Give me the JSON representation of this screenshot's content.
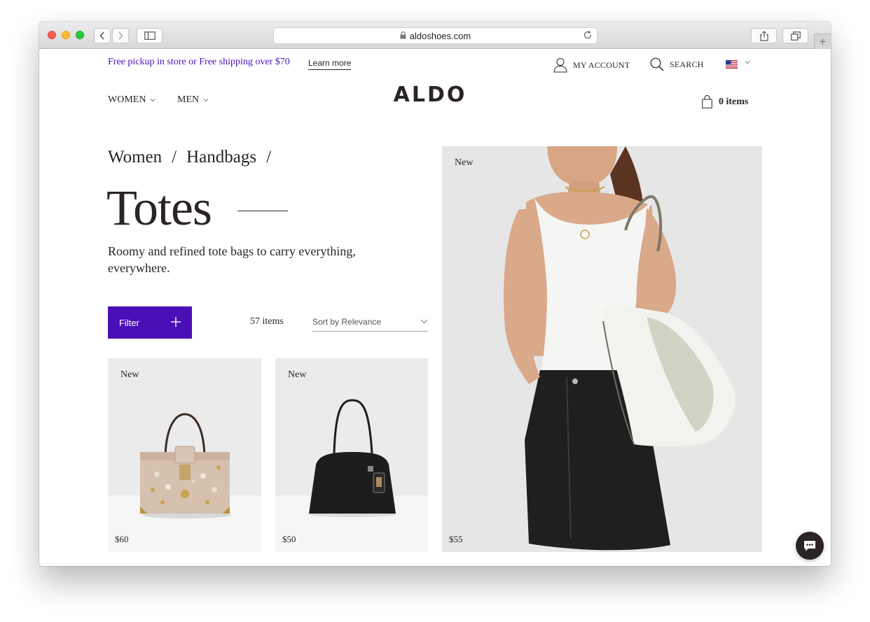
{
  "browser": {
    "url": "aldoshoes.com"
  },
  "topbar": {
    "promo": "Free pickup in store or Free shipping over $70",
    "learn_more": "Learn more",
    "account": "MY ACCOUNT",
    "search": "SEARCH",
    "country_flag": "us-flag-icon"
  },
  "header": {
    "nav": [
      "WOMEN",
      "MEN"
    ],
    "cart": "0 items"
  },
  "breadcrumb": {
    "items": [
      "Women",
      "Handbags"
    ],
    "separator": "/"
  },
  "category": {
    "title": "Totes",
    "description": "Roomy and refined tote bags to carry everything, everywhere."
  },
  "controls": {
    "filter_label": "Filter",
    "item_count": "57 items",
    "sort_label": "Sort by Relevance"
  },
  "products": [
    {
      "badge": "New",
      "price": "$60"
    },
    {
      "badge": "New",
      "price": "$50"
    },
    {
      "badge": "New",
      "price": "$55"
    }
  ],
  "colors": {
    "brand_purple": "#4b0fb8",
    "text_dark": "#2b2424"
  }
}
